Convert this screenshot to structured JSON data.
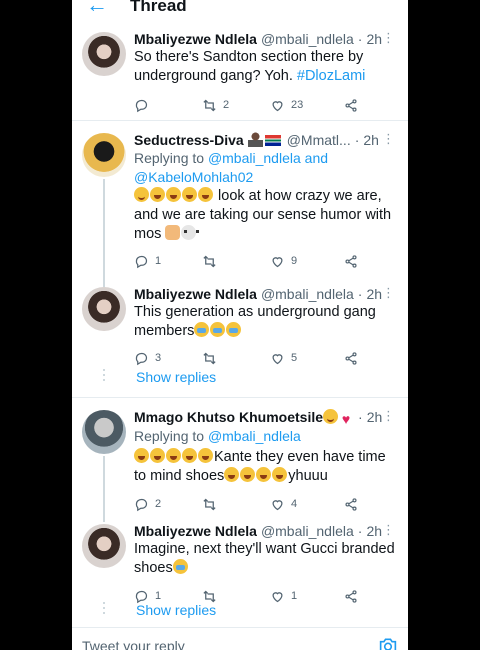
{
  "header": {
    "back_icon": "arrow-left-icon",
    "title": "Thread"
  },
  "tweets": [
    {
      "name": "Mbaliyezwe Ndlela",
      "handle": "@mbali_ndlela",
      "time": "2h",
      "text_before": "So there's Sandton section there by underground gang? Yoh. ",
      "hashtag": "#DlozLami",
      "replies": "",
      "retweets": "2",
      "likes": "23"
    },
    {
      "name": "Seductress-Diva",
      "handle": "@Mmatl...",
      "time": "2h",
      "reply_prefix": "Replying to ",
      "reply_user1": "@mbali_ndlela",
      "reply_and": " and",
      "reply_user2": "@KabeloMohlah02",
      "text": " look at how crazy we are, and we are taking our sense humor with mos ",
      "replies": "1",
      "retweets": "",
      "likes": "9"
    },
    {
      "name": "Mbaliyezwe Ndlela",
      "handle": "@mbali_ndlela",
      "time": "2h",
      "text": "This generation as underground gang members",
      "replies": "3",
      "retweets": "",
      "likes": "5",
      "show_replies": "Show replies"
    },
    {
      "name": "Mmago Khutso Khumoetsile",
      "handle": "",
      "time": "2h",
      "reply_prefix": "Replying to ",
      "reply_user1": "@mbali_ndlela",
      "text_a": "Kante they even have time to mind shoes",
      "text_b": "yhuuu",
      "replies": "2",
      "retweets": "",
      "likes": "4"
    },
    {
      "name": "Mbaliyezwe Ndlela",
      "handle": "@mbali_ndlela",
      "time": "2h",
      "text": "Imagine, next they'll want Gucci branded shoes",
      "replies": "1",
      "retweets": "",
      "likes": "1",
      "show_replies": "Show replies"
    }
  ],
  "composer": {
    "placeholder": "Tweet your reply",
    "camera_icon": "camera-icon"
  },
  "colors": {
    "accent": "#1d9bf0",
    "muted": "#536471",
    "background": "#000000"
  }
}
